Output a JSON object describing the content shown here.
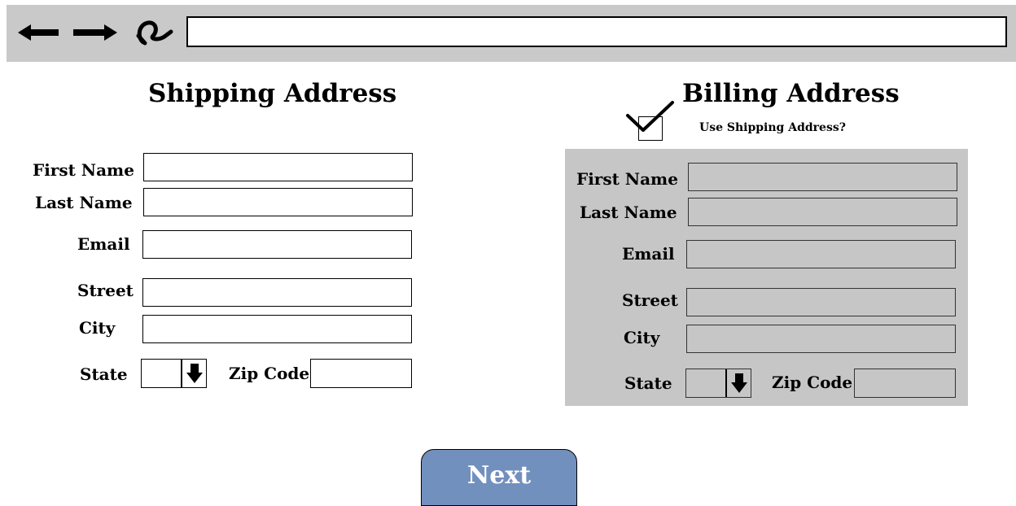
{
  "browser": {
    "url": ""
  },
  "shipping": {
    "title": "Shipping Address",
    "first_name_label": "First Name",
    "last_name_label": "Last Name",
    "email_label": "Email",
    "street_label": "Street",
    "city_label": "City",
    "state_label": "State",
    "zip_label": "Zip Code"
  },
  "billing": {
    "title": "Billing Address",
    "use_shipping_label": "Use Shipping Address?",
    "use_shipping_checked": true,
    "first_name_label": "First Name",
    "last_name_label": "Last Name",
    "email_label": "Email",
    "street_label": "Street",
    "city_label": "City",
    "state_label": "State",
    "zip_label": "Zip Code"
  },
  "actions": {
    "next_label": "Next"
  },
  "colors": {
    "toolbar": "#c9c9c9",
    "disabled_panel": "#c6c6c6",
    "next_button": "#7290bd"
  }
}
